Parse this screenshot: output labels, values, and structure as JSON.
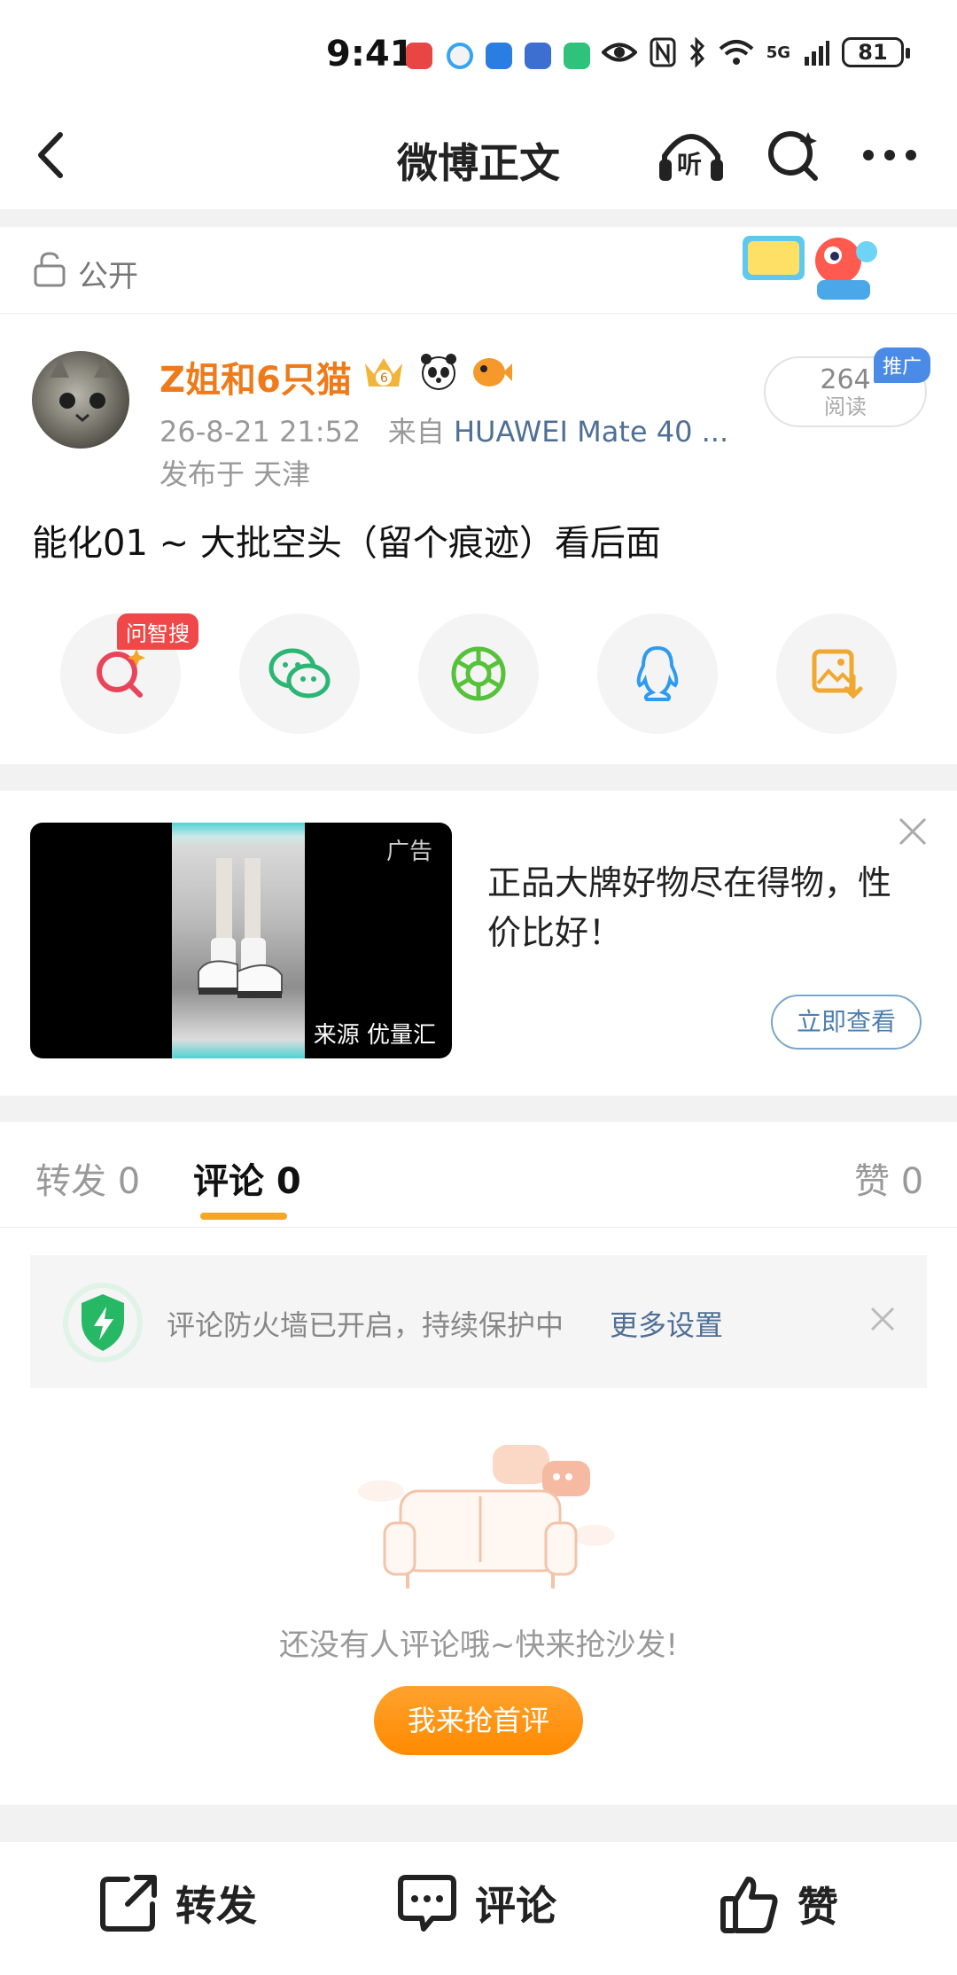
{
  "status_bar": {
    "time": "9:41",
    "network": "5G",
    "battery": "81"
  },
  "nav": {
    "title": "微博正文",
    "listen_label": "听"
  },
  "visibility": {
    "label": "公开"
  },
  "post": {
    "username": "Z姐和6只猫",
    "timestamp": "26-8-21 21:52",
    "source_prefix": "来自",
    "device": "HUAWEI Mate 40 ...",
    "location": "发布于 天津",
    "read_count": "264",
    "read_label": "阅读",
    "promo_tag": "推广",
    "text": "能化01 ~ 大批空头（留个痕迹）看后面"
  },
  "share": {
    "badge": "问智搜",
    "items": [
      "search-ai-icon",
      "wechat-icon",
      "moments-icon",
      "qq-icon",
      "save-image-icon"
    ]
  },
  "ad": {
    "label": "广告",
    "source": "来源 优量汇",
    "title": "正品大牌好物尽在得物，性价比好！",
    "button": "立即查看"
  },
  "tabs": {
    "repost": "转发 0",
    "comment": "评论 0",
    "like": "赞 0"
  },
  "notice": {
    "text": "评论防火墙已开启，持续保护中",
    "link": "更多设置"
  },
  "empty": {
    "text": "还没有人评论哦~快来抢沙发!",
    "button": "我来抢首评"
  },
  "bottom_bar": {
    "repost": "转发",
    "comment": "评论",
    "like": "赞"
  },
  "colors": {
    "accent": "#ff9a1a",
    "username": "#ee7a1a",
    "link": "#4f6f96"
  }
}
